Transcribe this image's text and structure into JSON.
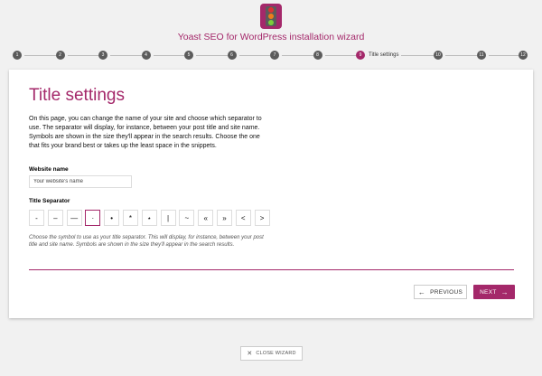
{
  "header": {
    "title": "Yoast SEO for WordPress installation wizard"
  },
  "steps": [
    {
      "num": "1"
    },
    {
      "num": "2"
    },
    {
      "num": "3"
    },
    {
      "num": "4"
    },
    {
      "num": "5"
    },
    {
      "num": "6"
    },
    {
      "num": "7"
    },
    {
      "num": "8"
    },
    {
      "num": "9",
      "label": "Title settings"
    },
    {
      "num": "10"
    },
    {
      "num": "11"
    },
    {
      "num": "12"
    }
  ],
  "page": {
    "title": "Title settings",
    "intro": "On this page, you can change the name of your site and choose which separator to use. The separator will display, for instance, between your post title and site name. Symbols are shown in the size they'll appear in the search results. Choose the one that fits your brand best or takes up the least space in the snippets.",
    "website_name_label": "Website name",
    "website_name_value": "Your website's name",
    "separator_label": "Title Separator",
    "separators": [
      "-",
      "–",
      "—",
      "·",
      "•",
      "*",
      "⋆",
      "|",
      "~",
      "«",
      "»",
      "<",
      ">"
    ],
    "selected_separator": "·",
    "help": "Choose the symbol to use as your title separator. This will display, for instance, between your post title and site name. Symbols are shown in the size they'll appear in the search results."
  },
  "nav": {
    "previous": "PREVIOUS",
    "next": "NEXT",
    "close": "CLOSE WIZARD"
  },
  "colors": {
    "accent": "#a4286a",
    "step_inactive": "#5b5b5b"
  },
  "icons": {
    "logo": "traffic-light-icon",
    "previous": "arrow-left-icon",
    "next": "arrow-right-icon",
    "close": "close-icon"
  }
}
